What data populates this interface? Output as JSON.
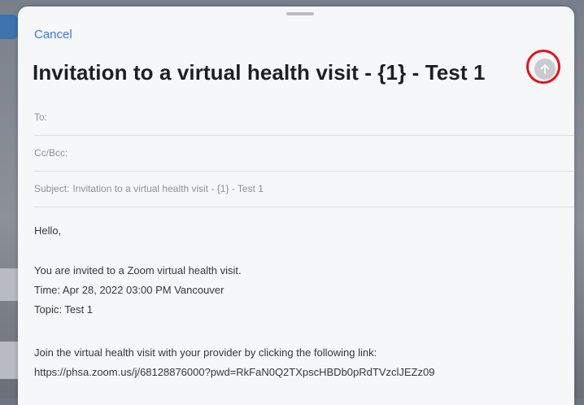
{
  "header": {
    "cancel_label": "Cancel",
    "title": "Invitation to a virtual health visit - {1} - Test 1",
    "send_icon": "arrow-up-icon",
    "highlight_color": "#e0151c"
  },
  "fields": {
    "to_label": "To:",
    "ccbcc_label": "Cc/Bcc:",
    "subject_label": "Subject:",
    "subject_value": "Invitation to a virtual health visit - {1} - Test 1"
  },
  "body": {
    "greeting": "Hello,",
    "line1": "You are invited to a Zoom virtual health visit.",
    "time_line": "Time: Apr 28, 2022 03:00 PM Vancouver",
    "topic_line": "Topic: Test 1",
    "join_line": "Join the virtual health visit with your provider by clicking the following link:",
    "link": "https://phsa.zoom.us/j/68128876000?pwd=RkFaN0Q2TXpscHBDb0pRdTVzclJEZz09"
  }
}
